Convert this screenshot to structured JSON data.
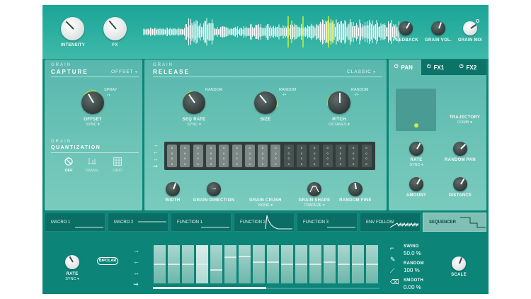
{
  "top_bar": {
    "intensity_label": "INTENSITY",
    "fx_label": "FX",
    "feedback_label": "FEEDBACK",
    "grain_vol_label": "GRAIN VOL.",
    "grain_mix_label": "GRAIN MIX"
  },
  "capture": {
    "title_top": "GRAIN",
    "title": "CAPTURE",
    "mode": "OFFSET",
    "offset_label": "OFFSET",
    "offset_sub": "SYNC",
    "spray_label": "SPRAY",
    "quant_top": "GRAIN",
    "quant_title": "QUANTIZATION",
    "quant_options": [
      "OFF",
      "TRANS.",
      "GRID"
    ]
  },
  "release": {
    "title_top": "GRAIN",
    "title": "RELEASE",
    "mode": "CLASSIC",
    "random_label": "RANDOM",
    "plusminus": "-/+",
    "seq_rate_label": "SEQ RATE",
    "seq_rate_sub": "SYNC",
    "size_label": "SIZE",
    "pitch_label": "PITCH",
    "pitch_sub": "OCTAVES",
    "width_label": "WIDTH",
    "grain_direction_label": "GRAIN DIRECTION",
    "grain_crush_label": "GRAIN CRUSH",
    "grain_crush_sub": "NONE",
    "grain_shape_label": "GRAIN SHAPE",
    "grain_shape_sub": "TRAPEZE",
    "random_fine_label": "RANDOM FINE",
    "step_values": [
      "0",
      "0",
      "0",
      "0",
      "0",
      "0",
      "0",
      "0",
      "0",
      "0",
      "0",
      "0",
      "0",
      "0",
      "0",
      "0"
    ]
  },
  "pan": {
    "tabs": [
      "PAN",
      "FX1",
      "FX2"
    ],
    "trajectory_label": "TRAJECTORY",
    "trajectory_sub": "COMB",
    "rate_label": "RATE",
    "rate_sub": "SYNC",
    "random_pan_label": "RANDOM PAN",
    "amount_label": "AMOUNT",
    "distance_label": "DISTANCE"
  },
  "macros": [
    "MACRO 1",
    "MACRO 2",
    "FUNCTION 1",
    "FUNCTION 2",
    "FUNCTION 3",
    "ENV FOLLOW",
    "SEQUENCER"
  ],
  "sequencer": {
    "rate_label": "RATE",
    "rate_sub": "SYNC",
    "bipolar_label": "BIPOLAR",
    "swing_label": "SWING",
    "swing_value": "50.0 %",
    "random_label": "RANDOM",
    "random_value": "100 %",
    "smooth_label": "SMOOTH",
    "smooth_value": "0.00 %",
    "scale_label": "SCALE",
    "step_levels": [
      0.5,
      0.5,
      0.5,
      0.5,
      0.35,
      0.7,
      0.72,
      0.55,
      0.55,
      0.5,
      0.5,
      0.5,
      0.55,
      0.5,
      0.5,
      0.5
    ]
  },
  "colors": {
    "accent": "#c8f03c",
    "panel": "#6cc3b6",
    "dark": "#0c8478"
  }
}
